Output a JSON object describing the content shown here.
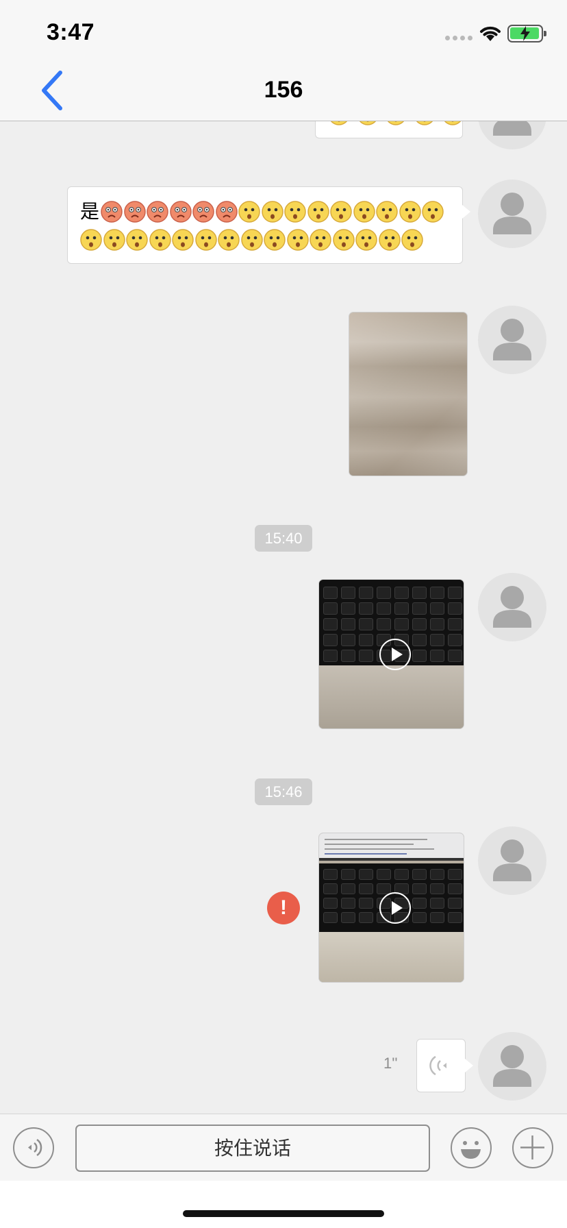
{
  "status_bar": {
    "time": "3:47"
  },
  "header": {
    "title": "156"
  },
  "messages": [
    {
      "type": "text",
      "prefix": "是",
      "emoji_red": 6,
      "emoji_yellow": 23
    },
    {
      "type": "image"
    },
    {
      "type": "timestamp",
      "time": "15:40"
    },
    {
      "type": "video"
    },
    {
      "type": "timestamp",
      "time": "15:46"
    },
    {
      "type": "video",
      "status": "failed",
      "error_icon": "!"
    },
    {
      "type": "voice",
      "duration": "1''"
    }
  ],
  "toolbar": {
    "hold_to_talk_label": "按住说话",
    "icons": [
      "voice-toggle-icon",
      "emoji-icon",
      "plus-icon"
    ]
  },
  "colors": {
    "back_arrow": "#3478f6",
    "error": "#e95e4a",
    "timestamp_bg": "#cecece",
    "chat_bg": "#efefef"
  }
}
